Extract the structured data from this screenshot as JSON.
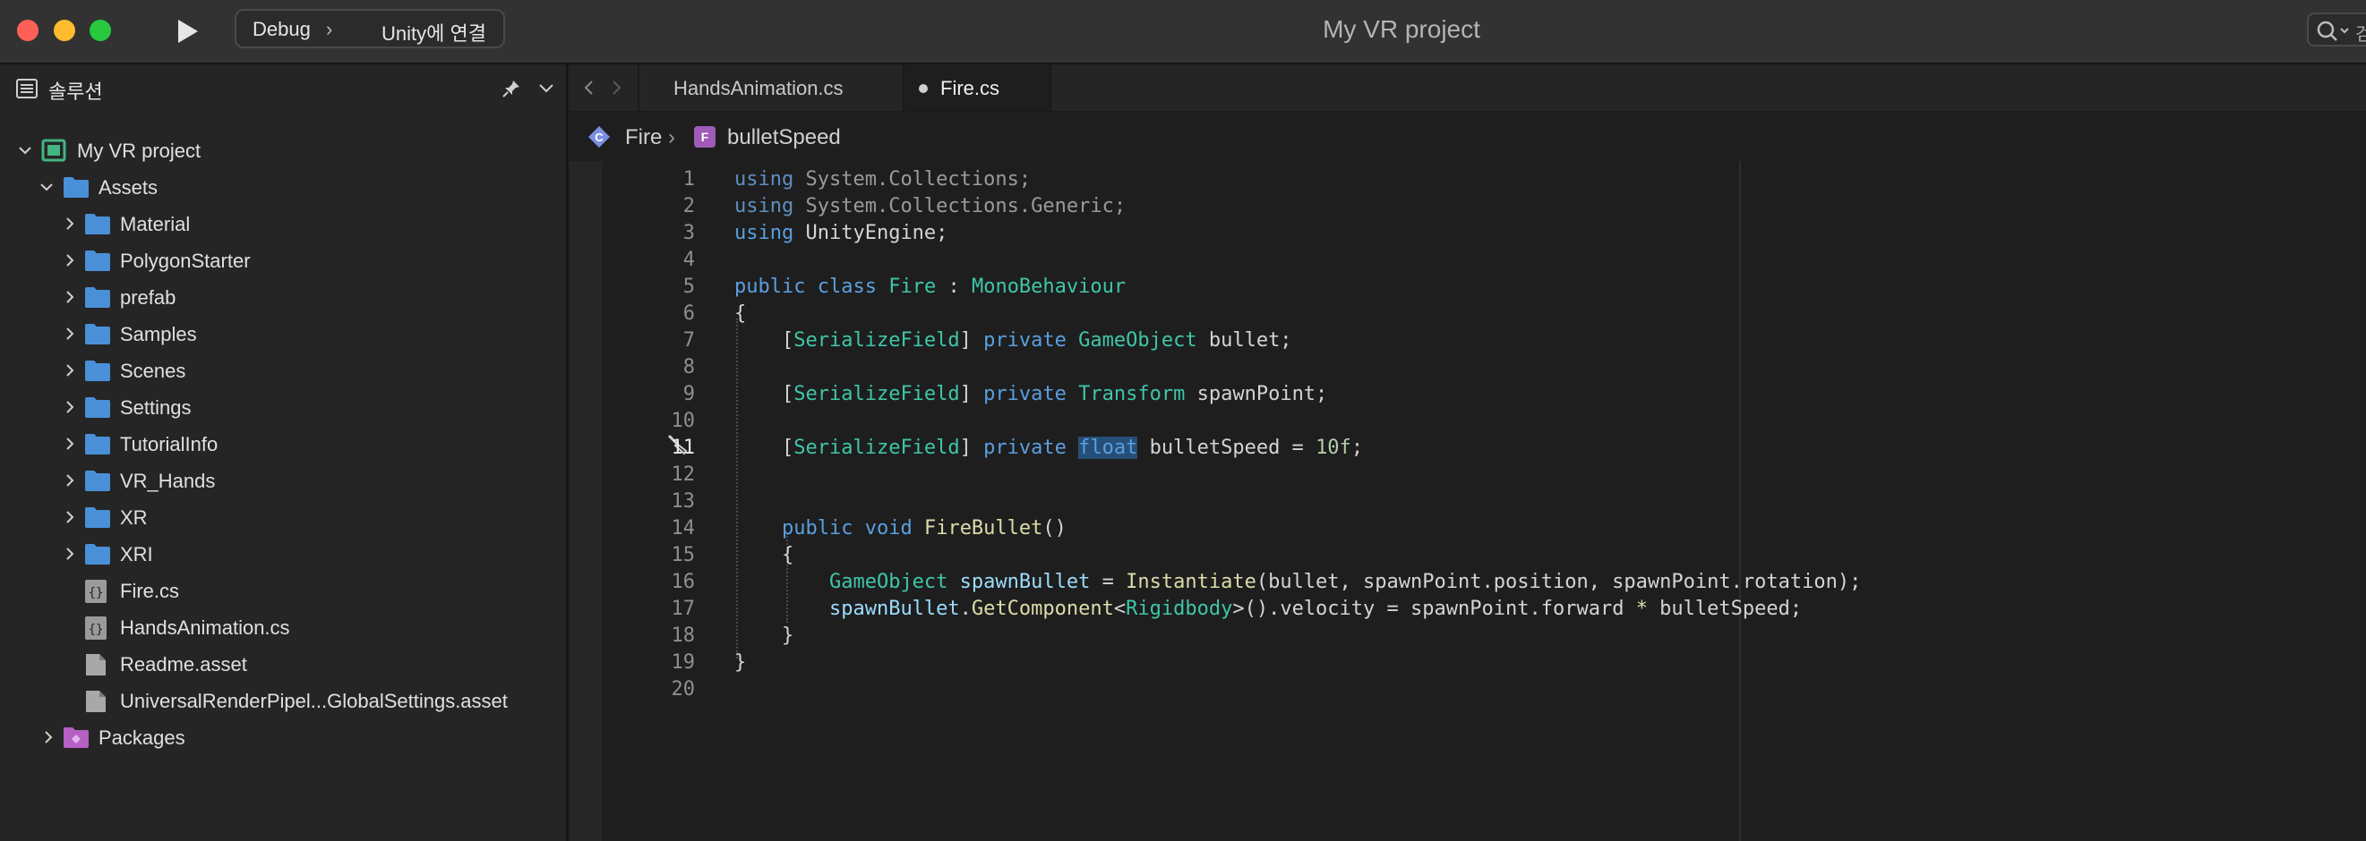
{
  "titlebar": {
    "config": "Debug",
    "config_separator": "›",
    "target": "Unity에 연결",
    "window_title": "My VR project",
    "search_truncated": "검"
  },
  "sidebar": {
    "title": "솔루션",
    "tree": [
      {
        "label": "My VR project",
        "icon": "solution-icon",
        "expanded": true,
        "level": 0
      },
      {
        "label": "Assets",
        "icon": "folder-icon",
        "expanded": true,
        "level": 1
      },
      {
        "label": "Material",
        "icon": "folder-icon",
        "expanded": false,
        "level": 2
      },
      {
        "label": "PolygonStarter",
        "icon": "folder-icon",
        "expanded": false,
        "level": 2
      },
      {
        "label": "prefab",
        "icon": "folder-icon",
        "expanded": false,
        "level": 2
      },
      {
        "label": "Samples",
        "icon": "folder-icon",
        "expanded": false,
        "level": 2
      },
      {
        "label": "Scenes",
        "icon": "folder-icon",
        "expanded": false,
        "level": 2
      },
      {
        "label": "Settings",
        "icon": "folder-icon",
        "expanded": false,
        "level": 2
      },
      {
        "label": "TutorialInfo",
        "icon": "folder-icon",
        "expanded": false,
        "level": 2
      },
      {
        "label": "VR_Hands",
        "icon": "folder-icon",
        "expanded": false,
        "level": 2
      },
      {
        "label": "XR",
        "icon": "folder-icon",
        "expanded": false,
        "level": 2
      },
      {
        "label": "XRI",
        "icon": "folder-icon",
        "expanded": false,
        "level": 2
      },
      {
        "label": "Fire.cs",
        "icon": "csharp-file-icon",
        "level": 2
      },
      {
        "label": "HandsAnimation.cs",
        "icon": "csharp-file-icon",
        "level": 2
      },
      {
        "label": "Readme.asset",
        "icon": "file-icon",
        "level": 2
      },
      {
        "label": "UniversalRenderPipel...GlobalSettings.asset",
        "icon": "file-icon",
        "level": 2
      },
      {
        "label": "Packages",
        "icon": "packages-folder-icon",
        "expanded": false,
        "level": 1
      }
    ]
  },
  "tabs": [
    {
      "label": "HandsAnimation.cs",
      "active": false
    },
    {
      "label": "Fire.cs",
      "active": true,
      "modified": true
    }
  ],
  "breadcrumb": {
    "class_name": "Fire",
    "separator": "›",
    "field_name": "bulletSpeed"
  },
  "editor": {
    "current_line": 11,
    "line_numbers": [
      "1",
      "2",
      "3",
      "4",
      "5",
      "6",
      "7",
      "8",
      "9",
      "10",
      "11",
      "12",
      "13",
      "14",
      "15",
      "16",
      "17",
      "18",
      "19",
      "20"
    ],
    "code_lines": [
      "using System.Collections;",
      "using System.Collections.Generic;",
      "using UnityEngine;",
      "",
      "public class Fire : MonoBehaviour",
      "{",
      "    [SerializeField] private GameObject bullet;",
      "",
      "    [SerializeField] private Transform spawnPoint;",
      "",
      "    [SerializeField] private float bulletSpeed = 10f;",
      "",
      "",
      "    public void FireBullet()",
      "    {",
      "        GameObject spawnBullet = Instantiate(bullet, spawnPoint.position, spawnPoint.rotation);",
      "        spawnBullet.GetComponent<Rigidbody>().velocity = spawnPoint.forward * bulletSpeed;",
      "    }",
      "}",
      ""
    ]
  },
  "colors": {
    "keyword": "#5a9fe0",
    "type": "#3fc6a8",
    "function": "#dcdcaa",
    "number": "#b5cea8",
    "folder": "#4a90d9",
    "selection": "#264f78"
  }
}
